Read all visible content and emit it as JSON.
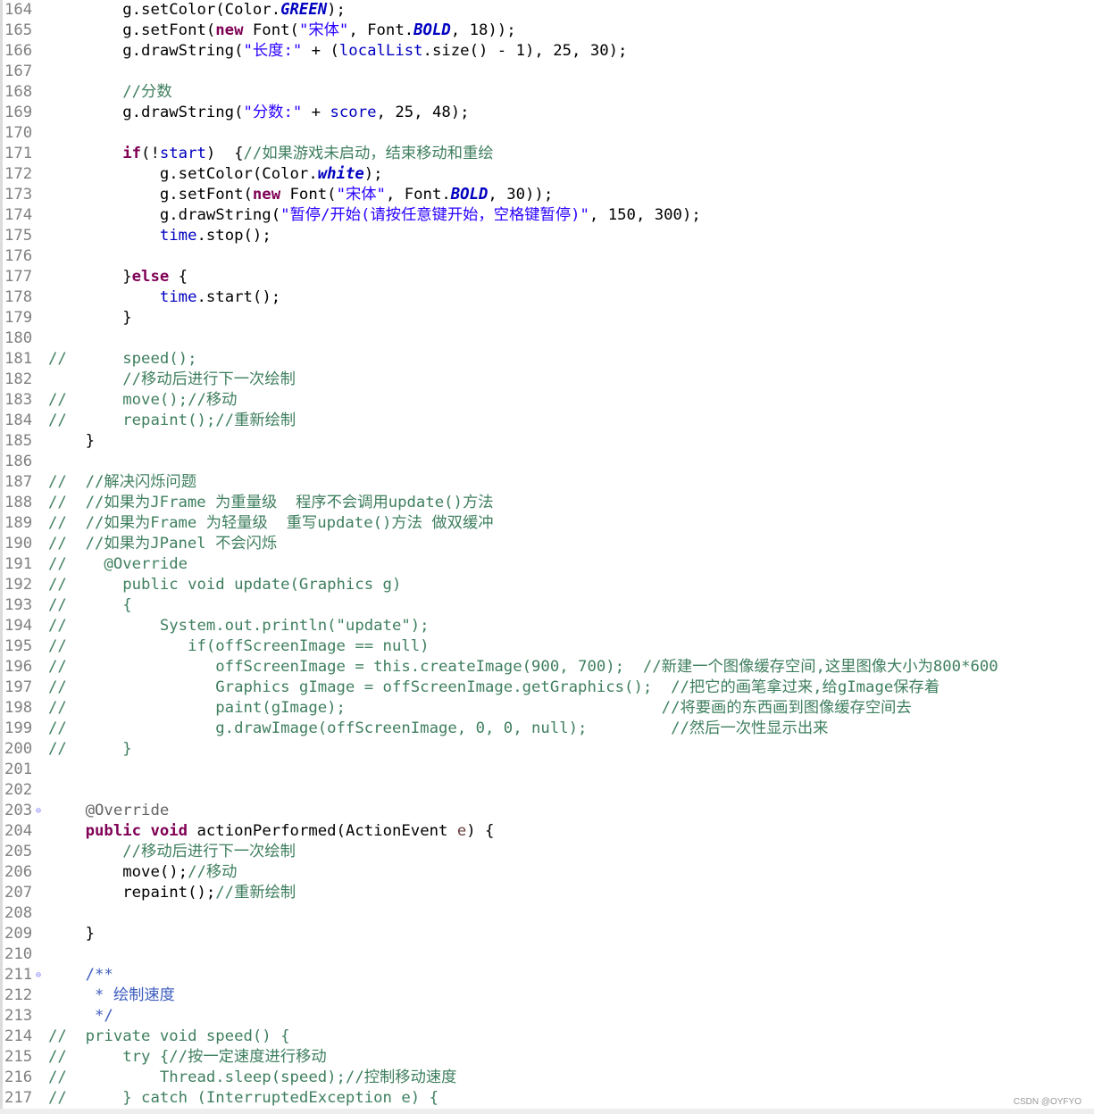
{
  "lines": [
    {
      "n": "164",
      "fold": "",
      "parts": [
        [
          "plain",
          "        g.setColor(Color."
        ],
        [
          "const",
          "GREEN"
        ],
        [
          "plain",
          ");"
        ]
      ]
    },
    {
      "n": "165",
      "fold": "",
      "parts": [
        [
          "plain",
          "        g.setFont("
        ],
        [
          "kw",
          "new"
        ],
        [
          "plain",
          " Font("
        ],
        [
          "str",
          "\"宋体\""
        ],
        [
          "plain",
          ", Font."
        ],
        [
          "const",
          "BOLD"
        ],
        [
          "plain",
          ", 18));"
        ]
      ]
    },
    {
      "n": "166",
      "fold": "",
      "parts": [
        [
          "plain",
          "        g.drawString("
        ],
        [
          "str",
          "\"长度:\""
        ],
        [
          "plain",
          " + ("
        ],
        [
          "field",
          "localList"
        ],
        [
          "plain",
          ".size() - 1), 25, 30);"
        ]
      ]
    },
    {
      "n": "167",
      "fold": "",
      "parts": []
    },
    {
      "n": "168",
      "fold": "",
      "parts": [
        [
          "cm",
          "        //分数"
        ]
      ]
    },
    {
      "n": "169",
      "fold": "",
      "parts": [
        [
          "plain",
          "        g.drawString("
        ],
        [
          "str",
          "\"分数:\""
        ],
        [
          "plain",
          " + "
        ],
        [
          "field",
          "score"
        ],
        [
          "plain",
          ", 25, 48);"
        ]
      ]
    },
    {
      "n": "170",
      "fold": "",
      "parts": []
    },
    {
      "n": "171",
      "fold": "",
      "parts": [
        [
          "plain",
          "        "
        ],
        [
          "kw",
          "if"
        ],
        [
          "plain",
          "(!"
        ],
        [
          "field",
          "start"
        ],
        [
          "plain",
          ")  {"
        ],
        [
          "cm",
          "//如果游戏未启动，结束移动和重绘"
        ]
      ]
    },
    {
      "n": "172",
      "fold": "",
      "parts": [
        [
          "plain",
          "            g.setColor(Color."
        ],
        [
          "const",
          "white"
        ],
        [
          "plain",
          ");"
        ]
      ]
    },
    {
      "n": "173",
      "fold": "",
      "parts": [
        [
          "plain",
          "            g.setFont("
        ],
        [
          "kw",
          "new"
        ],
        [
          "plain",
          " Font("
        ],
        [
          "str",
          "\"宋体\""
        ],
        [
          "plain",
          ", Font."
        ],
        [
          "const",
          "BOLD"
        ],
        [
          "plain",
          ", 30));"
        ]
      ]
    },
    {
      "n": "174",
      "fold": "",
      "parts": [
        [
          "plain",
          "            g.drawString("
        ],
        [
          "str",
          "\"暂停/开始(请按任意键开始，空格键暂停)\""
        ],
        [
          "plain",
          ", 150, 300);"
        ]
      ]
    },
    {
      "n": "175",
      "fold": "",
      "parts": [
        [
          "plain",
          "            "
        ],
        [
          "field",
          "time"
        ],
        [
          "plain",
          ".stop();"
        ]
      ]
    },
    {
      "n": "176",
      "fold": "",
      "parts": []
    },
    {
      "n": "177",
      "fold": "",
      "parts": [
        [
          "plain",
          "        }"
        ],
        [
          "kw",
          "else"
        ],
        [
          "plain",
          " {"
        ]
      ]
    },
    {
      "n": "178",
      "fold": "",
      "parts": [
        [
          "plain",
          "            "
        ],
        [
          "field",
          "time"
        ],
        [
          "plain",
          ".start();"
        ]
      ]
    },
    {
      "n": "179",
      "fold": "",
      "parts": [
        [
          "plain",
          "        }"
        ]
      ]
    },
    {
      "n": "180",
      "fold": "",
      "parts": []
    },
    {
      "n": "181",
      "fold": "",
      "parts": [
        [
          "cm",
          "//      speed();"
        ]
      ]
    },
    {
      "n": "182",
      "fold": "",
      "parts": [
        [
          "cm",
          "        //移动后进行下一次绘制"
        ]
      ]
    },
    {
      "n": "183",
      "fold": "",
      "parts": [
        [
          "cm",
          "//      move();//移动"
        ]
      ]
    },
    {
      "n": "184",
      "fold": "",
      "parts": [
        [
          "cm",
          "//      repaint();//重新绘制"
        ]
      ]
    },
    {
      "n": "185",
      "fold": "",
      "parts": [
        [
          "plain",
          "    }"
        ]
      ]
    },
    {
      "n": "186",
      "fold": "",
      "parts": []
    },
    {
      "n": "187",
      "fold": "",
      "parts": [
        [
          "cm",
          "//  //解决闪烁问题"
        ]
      ]
    },
    {
      "n": "188",
      "fold": "",
      "parts": [
        [
          "cm",
          "//  //如果为JFrame 为重量级  程序不会调用update()方法"
        ]
      ]
    },
    {
      "n": "189",
      "fold": "",
      "parts": [
        [
          "cm",
          "//  //如果为Frame 为轻量级  重写update()方法 做双缓冲"
        ]
      ]
    },
    {
      "n": "190",
      "fold": "",
      "parts": [
        [
          "cm",
          "//  //如果为JPanel 不会闪烁"
        ]
      ]
    },
    {
      "n": "191",
      "fold": "",
      "parts": [
        [
          "cm",
          "//    @Override"
        ]
      ]
    },
    {
      "n": "192",
      "fold": "",
      "parts": [
        [
          "cm",
          "//      public void update(Graphics g)"
        ]
      ]
    },
    {
      "n": "193",
      "fold": "",
      "parts": [
        [
          "cm",
          "//      {"
        ]
      ]
    },
    {
      "n": "194",
      "fold": "",
      "parts": [
        [
          "cm",
          "//          System.out.println(\"update\");"
        ]
      ]
    },
    {
      "n": "195",
      "fold": "",
      "parts": [
        [
          "cm",
          "//             if(offScreenImage == null)"
        ]
      ]
    },
    {
      "n": "196",
      "fold": "",
      "parts": [
        [
          "cm",
          "//                offScreenImage = this.createImage(900, 700);  //新建一个图像缓存空间,这里图像大小为800*600"
        ]
      ]
    },
    {
      "n": "197",
      "fold": "",
      "parts": [
        [
          "cm",
          "//                Graphics gImage = offScreenImage.getGraphics();  //把它的画笔拿过来,给gImage保存着"
        ]
      ]
    },
    {
      "n": "198",
      "fold": "",
      "parts": [
        [
          "cm",
          "//                paint(gImage);                                  //将要画的东西画到图像缓存空间去"
        ]
      ]
    },
    {
      "n": "199",
      "fold": "",
      "parts": [
        [
          "cm",
          "//                g.drawImage(offScreenImage, 0, 0, null);         //然后一次性显示出来"
        ]
      ]
    },
    {
      "n": "200",
      "fold": "",
      "parts": [
        [
          "cm",
          "//      }"
        ]
      ]
    },
    {
      "n": "201",
      "fold": "",
      "parts": []
    },
    {
      "n": "202",
      "fold": "",
      "parts": []
    },
    {
      "n": "203",
      "fold": "⊖",
      "parts": [
        [
          "ann",
          "    @Override"
        ]
      ]
    },
    {
      "n": "204",
      "fold": "",
      "parts": [
        [
          "plain",
          "    "
        ],
        [
          "kw",
          "public"
        ],
        [
          "plain",
          " "
        ],
        [
          "kw",
          "void"
        ],
        [
          "plain",
          " actionPerformed(ActionEvent "
        ],
        [
          "local",
          "e"
        ],
        [
          "plain",
          ") {"
        ]
      ]
    },
    {
      "n": "205",
      "fold": "",
      "parts": [
        [
          "cm",
          "        //移动后进行下一次绘制"
        ]
      ]
    },
    {
      "n": "206",
      "fold": "",
      "parts": [
        [
          "plain",
          "        move();"
        ],
        [
          "cm",
          "//移动"
        ]
      ]
    },
    {
      "n": "207",
      "fold": "",
      "parts": [
        [
          "plain",
          "        repaint();"
        ],
        [
          "cm",
          "//重新绘制"
        ]
      ]
    },
    {
      "n": "208",
      "fold": "",
      "parts": []
    },
    {
      "n": "209",
      "fold": "",
      "parts": [
        [
          "plain",
          "    }"
        ]
      ]
    },
    {
      "n": "210",
      "fold": "",
      "parts": []
    },
    {
      "n": "211",
      "fold": "⊖",
      "parts": [
        [
          "jd",
          "    /**"
        ]
      ]
    },
    {
      "n": "212",
      "fold": "",
      "parts": [
        [
          "jd",
          "     * 绘制速度"
        ]
      ]
    },
    {
      "n": "213",
      "fold": "",
      "parts": [
        [
          "jd",
          "     */"
        ]
      ]
    },
    {
      "n": "214",
      "fold": "",
      "parts": [
        [
          "cm",
          "//  private void speed() {"
        ]
      ]
    },
    {
      "n": "215",
      "fold": "",
      "parts": [
        [
          "cm",
          "//      try {//按一定速度进行移动"
        ]
      ]
    },
    {
      "n": "216",
      "fold": "",
      "parts": [
        [
          "cm",
          "//          Thread.sleep(speed);//控制移动速度"
        ]
      ]
    },
    {
      "n": "217",
      "fold": "",
      "parts": [
        [
          "cm",
          "//      } catch (InterruptedException e) {"
        ]
      ]
    }
  ],
  "watermark": "CSDN @OYFYO"
}
